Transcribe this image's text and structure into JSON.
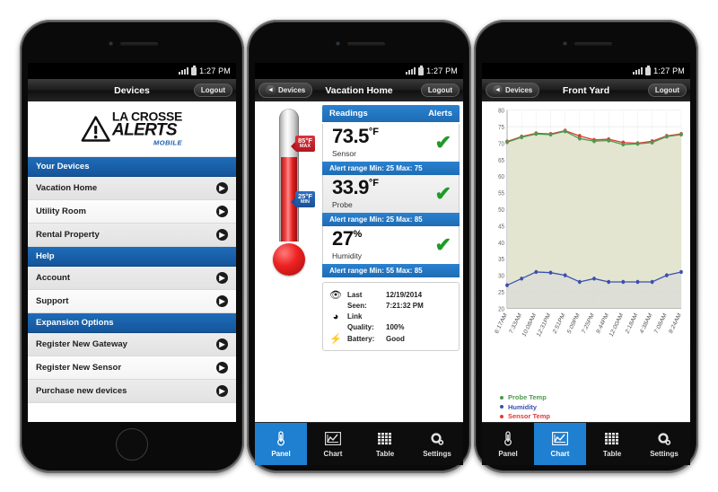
{
  "status_bar": {
    "time": "1:27 PM",
    "signal_icon": "signal-bars-icon",
    "battery_icon": "battery-icon"
  },
  "phone1": {
    "nav": {
      "title": "Devices",
      "logout_label": "Logout"
    },
    "logo": {
      "line1": "LA CROSSE",
      "line2": "ALERTS",
      "line3": "MOBILE",
      "icon": "warning-triangle-icon"
    },
    "sections": [
      {
        "header": "Your Devices",
        "items": [
          "Vacation Home",
          "Utility Room",
          "Rental Property"
        ]
      },
      {
        "header": "Help",
        "items": [
          "Account",
          "Support"
        ]
      },
      {
        "header": "Expansion Options",
        "items": [
          "Register New Gateway",
          "Register New Sensor",
          "Purchase new devices"
        ]
      }
    ],
    "chevron_icon": "chevron-right-icon"
  },
  "phone2": {
    "nav": {
      "back_label": "Devices",
      "title": "Vacation Home",
      "logout_label": "Logout",
      "back_icon": "chevron-left-icon"
    },
    "thermometer": {
      "ticks": [
        120,
        100,
        80,
        60,
        40,
        20,
        0,
        -20
      ],
      "max_tag": {
        "value": "85°F",
        "label": "MAX"
      },
      "min_tag": {
        "value": "25°F",
        "label": "MIN"
      }
    },
    "readings_header": {
      "left": "Readings",
      "right": "Alerts"
    },
    "readings": [
      {
        "value": "73.5",
        "unit": "°F",
        "label": "Sensor",
        "status_icon": "check-icon",
        "alert_range": "Alert range Min: 25  Max: 75"
      },
      {
        "value": "33.9",
        "unit": "°F",
        "label": "Probe",
        "status_icon": "check-icon",
        "alert_range": "Alert range Min: 25  Max: 85"
      },
      {
        "value": "27",
        "unit": "%",
        "label": "Humidity",
        "status_icon": "check-icon",
        "alert_range": "Alert range Min: 55  Max: 85"
      }
    ],
    "info": [
      {
        "icon": "eye-icon",
        "label": "Last Seen:",
        "label1": "Last",
        "label2": "Seen:",
        "value1": "12/19/2014",
        "value2": "7:21:32 PM"
      },
      {
        "icon": "wifi-icon",
        "label1": "Link",
        "label2": "Quality:",
        "value1": "",
        "value2": "100%"
      },
      {
        "icon": "bolt-icon",
        "label1": "",
        "label2": "Battery:",
        "value1": "",
        "value2": "Good"
      }
    ],
    "tabs": [
      {
        "label": "Panel",
        "icon": "thermometer-icon",
        "active": true
      },
      {
        "label": "Chart",
        "icon": "line-chart-icon",
        "active": false
      },
      {
        "label": "Table",
        "icon": "grid-table-icon",
        "active": false
      },
      {
        "label": "Settings",
        "icon": "gear-icon",
        "active": false
      }
    ]
  },
  "phone3": {
    "nav": {
      "back_label": "Devices",
      "title": "Front Yard",
      "logout_label": "Logout",
      "back_icon": "chevron-left-icon"
    },
    "tabs": [
      {
        "label": "Panel",
        "icon": "thermometer-icon",
        "active": false
      },
      {
        "label": "Chart",
        "icon": "line-chart-icon",
        "active": true
      },
      {
        "label": "Table",
        "icon": "grid-table-icon",
        "active": false
      },
      {
        "label": "Settings",
        "icon": "gear-icon",
        "active": false
      }
    ]
  },
  "chart_data": {
    "type": "line",
    "title": "",
    "xlabel": "",
    "ylabel": "",
    "ylim": [
      20,
      80
    ],
    "yticks": [
      20,
      25,
      30,
      35,
      40,
      45,
      50,
      55,
      60,
      65,
      70,
      75,
      80
    ],
    "grid": true,
    "legend_position": "below-left",
    "categories": [
      "6:17AM",
      "7:33AM",
      "10:08AM",
      "12:31PM",
      "2:51PM",
      "5:09PM",
      "7:25PM",
      "9:44PM",
      "12:00AM",
      "2:18AM",
      "4:38AM",
      "7:08AM",
      "9:24AM"
    ],
    "series": [
      {
        "name": "Sensor Temp",
        "color": "#e03a3a",
        "values": [
          70.5,
          72.0,
          73.0,
          72.8,
          73.8,
          72.2,
          71.0,
          71.2,
          70.2,
          70.0,
          70.6,
          72.2,
          72.8
        ]
      },
      {
        "name": "Probe Temp",
        "color": "#4c9a4c",
        "values": [
          70.3,
          71.8,
          72.8,
          72.6,
          73.6,
          71.4,
          70.6,
          70.8,
          69.6,
          69.8,
          70.2,
          72.0,
          72.6
        ]
      },
      {
        "name": "Humidity",
        "color": "#3a4fb0",
        "values": [
          27,
          29,
          31,
          30.8,
          30,
          28,
          29,
          28,
          28,
          28,
          28,
          30,
          31
        ]
      }
    ]
  }
}
